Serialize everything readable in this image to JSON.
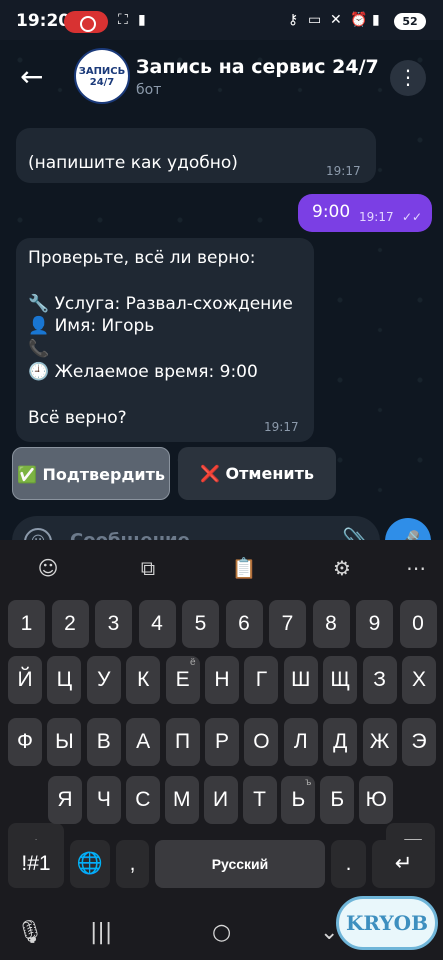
{
  "status_bar": {
    "time": "19:20",
    "battery": "52",
    "icons": [
      "record-icon",
      "screenshot-icon",
      "signal-icon",
      "key-icon",
      "cast-icon",
      "mute-icon",
      "alarm-icon",
      "wifi-icon",
      "signal-bars-icon",
      "battery-icon"
    ]
  },
  "header": {
    "title": "Запись на сервис 24/7",
    "subtitle": "бот",
    "avatar_text": "ЗАПИСЬ 24/7"
  },
  "messages": {
    "m1": {
      "text": "(напишите как удобно)",
      "time": "19:17"
    },
    "m2": {
      "text": "9:00",
      "time": "19:17"
    },
    "m3": {
      "lines": [
        "Проверьте, всё ли верно:",
        "🔧 Услуга: Развал-схождение",
        "👤 Имя: Игорь",
        "📞",
        "🕘 Желаемое время: 9:00",
        "Всё верно?"
      ],
      "time": "19:17"
    }
  },
  "inline_buttons": {
    "confirm": "✅ Подтвердить",
    "cancel": "❌ Отменить"
  },
  "input": {
    "placeholder": "Сообщение"
  },
  "keyboard": {
    "numbers": [
      "1",
      "2",
      "3",
      "4",
      "5",
      "6",
      "7",
      "8",
      "9",
      "0"
    ],
    "row1": [
      "Й",
      "Ц",
      "У",
      "К",
      "Е",
      "Н",
      "Г",
      "Ш",
      "Щ",
      "З",
      "Х"
    ],
    "row1_hint": "ё",
    "row2": [
      "Ф",
      "Ы",
      "В",
      "А",
      "П",
      "Р",
      "О",
      "Л",
      "Д",
      "Ж",
      "Э"
    ],
    "row3": [
      "Я",
      "Ч",
      "С",
      "М",
      "И",
      "Т",
      "Ь",
      "Б",
      "Ю"
    ],
    "row3_hint": "ъ",
    "sym": "!#1",
    "comma": ",",
    "space": "Русский",
    "period": ".",
    "backspace": "⌫",
    "enter": "↵",
    "shift": "⇧"
  },
  "watermark": "KRYOB"
}
